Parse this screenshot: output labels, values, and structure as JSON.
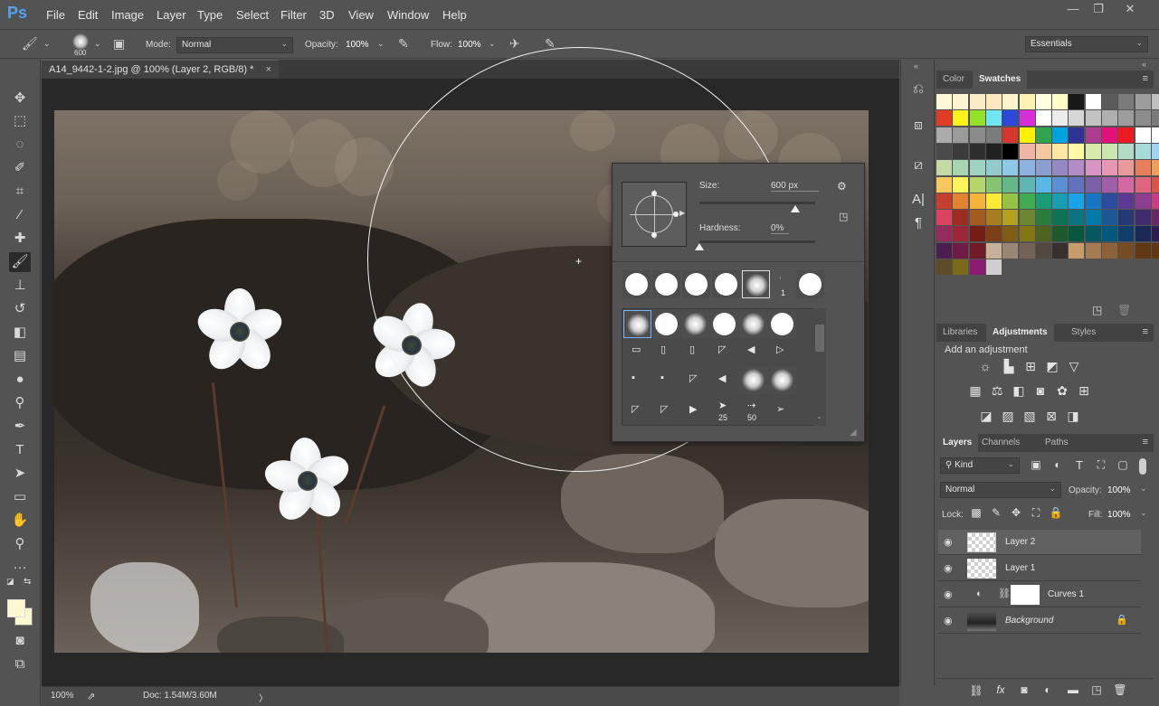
{
  "app": {
    "logo": "Ps"
  },
  "menu": [
    "File",
    "Edit",
    "Image",
    "Layer",
    "Type",
    "Select",
    "Filter",
    "3D",
    "View",
    "Window",
    "Help"
  ],
  "window_controls": [
    "—",
    "❐",
    "✕"
  ],
  "options_bar": {
    "brush_size": "600",
    "mode_label": "Mode:",
    "mode_value": "Normal",
    "opacity_label": "Opacity:",
    "opacity_value": "100%",
    "flow_label": "Flow:",
    "flow_value": "100%",
    "workspace": "Essentials"
  },
  "document": {
    "tab_title": "A14_9442-1-2.jpg @ 100% (Layer 2, RGB/8) *",
    "close": "×"
  },
  "brush_picker": {
    "size_label": "Size:",
    "size_value": "600 px",
    "hardness_label": "Hardness:",
    "hardness_value": "0%",
    "size_fraction": 0.83,
    "hardness_fraction": 0.0,
    "preset_small_label_1": "1",
    "preset_small_label_dot": "·",
    "tip_labels": [
      "25",
      "50"
    ]
  },
  "panels": {
    "color_tabs": [
      "Color",
      "Swatches"
    ],
    "adjust_tabs": [
      "Libraries",
      "Adjustments",
      "Styles"
    ],
    "adjust_hint": "Add an adjustment",
    "layers_tabs": [
      "Layers",
      "Channels",
      "Paths"
    ],
    "filter_kind": "Kind",
    "blend_mode": "Normal",
    "opacity_label": "Opacity:",
    "opacity_value": "100%",
    "lock_label": "Lock:",
    "fill_label": "Fill:",
    "fill_value": "100%"
  },
  "layers": [
    {
      "name": "Layer 2",
      "selected": true
    },
    {
      "name": "Layer 1",
      "selected": false
    },
    {
      "name": "Curves 1",
      "selected": false
    },
    {
      "name": "Background",
      "selected": false
    }
  ],
  "status": {
    "zoom": "100%",
    "doc": "Doc: 1.54M/3.60M",
    "arrow": "〉"
  },
  "swatch_colors": [
    "#fff8d7",
    "#fff5cf",
    "#fcebc7",
    "#ffe8bd",
    "#fff3cd",
    "#fff2b3",
    "#ffffe0",
    "#fffcc7",
    "#181818",
    "#ffffff",
    "#5a5a5a",
    "#7b7b7b",
    "#9d9d9d",
    "#bfbfbf",
    "#e23b26",
    "#f9f21d",
    "#92e129",
    "#6fe7f3",
    "#2c48d9",
    "#d62fd9",
    "#ffffff",
    "#ececec",
    "#d6d6d6",
    "#c2c2c2",
    "#afafaf",
    "#9d9d9d",
    "#8c8c8c",
    "#7b7b7b",
    "#ababab",
    "#9b9b9b",
    "#8b8b8b",
    "#7c7c7c",
    "#d6362c",
    "#fff200",
    "#31a54e",
    "#00a2e1",
    "#2f3493",
    "#ad3d8e",
    "#e2127a",
    "#eb1b24",
    "#ffffff",
    "#ffffff",
    "#4a4a4a",
    "#3b3b3b",
    "#2e2e2e",
    "#212121",
    "#000000",
    "#f1b6a3",
    "#f3c9a2",
    "#fde7a3",
    "#fff9a8",
    "#d9ebab",
    "#cbe5b0",
    "#b1dbc6",
    "#a7dbda",
    "#a1d2f0",
    "#c4daa4",
    "#a7d6b2",
    "#9fd4c3",
    "#92cbcd",
    "#8ec8e9",
    "#8cb3df",
    "#8c9dd0",
    "#9689c3",
    "#b28cc5",
    "#d794c5",
    "#e796b4",
    "#ea9a9a",
    "#e77e5c",
    "#ee9d5b",
    "#f8c85b",
    "#fff35b",
    "#b6d66b",
    "#86c373",
    "#66b88a",
    "#5fb5b4",
    "#5bb7e6",
    "#5b8fd1",
    "#6272bd",
    "#7d5faa",
    "#a25fa9",
    "#d468a4",
    "#e0667f",
    "#d95449",
    "#c63e2d",
    "#e3822f",
    "#f5b33a",
    "#fdea37",
    "#94c244",
    "#41ab52",
    "#1a9c74",
    "#1a9db1",
    "#1aa3e8",
    "#1776c3",
    "#2c4d9e",
    "#5a3a92",
    "#8f3c93",
    "#c93e82",
    "#d9435f",
    "#9d2d20",
    "#a45a1f",
    "#a87d20",
    "#b3a11f",
    "#6b8830",
    "#2a7c3d",
    "#0e7354",
    "#0b7381",
    "#0479ab",
    "#1e5796",
    "#253974",
    "#412b6c",
    "#68296b",
    "#952a5c",
    "#9c2738",
    "#751c13",
    "#7b4115",
    "#7f5d16",
    "#837715",
    "#4d6321",
    "#1c5a2c",
    "#08563d",
    "#045862",
    "#02587f",
    "#123e6e",
    "#1a2956",
    "#2e1e50",
    "#4c1e50",
    "#6e1c44",
    "#721a28",
    "#c7b299",
    "#998675",
    "#736357",
    "#534741",
    "#37302c",
    "#c69c6d",
    "#a57c52",
    "#8c6239",
    "#754c24",
    "#603813",
    "#603813",
    "#5f4b2a",
    "#7a6a1a",
    "#8b1a72",
    "#cfcfcf"
  ]
}
